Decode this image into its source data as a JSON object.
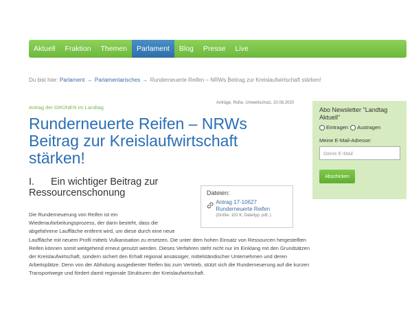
{
  "nav": {
    "items": [
      {
        "label": "Aktuell"
      },
      {
        "label": "Fraktion"
      },
      {
        "label": "Themen"
      },
      {
        "label": "Parlament"
      },
      {
        "label": "Blog"
      },
      {
        "label": "Presse"
      },
      {
        "label": "Live"
      }
    ],
    "active_index": 3
  },
  "breadcrumb": {
    "prefix": "Du bist hier:",
    "items": [
      "Parlament",
      "Parlamentarisches"
    ],
    "separator": "→",
    "current": "Runderneuerte Reifen – NRWs Beitrag zur Kreislaufwirtschaft stärken!"
  },
  "article": {
    "kicker": "Antrag der GRÜNEN im Landtag",
    "meta": "Anträge, Roße, Umweltschutz, 20.08.2020",
    "title": "Runderneuerte Reifen – NRWs Beitrag zur Kreislaufwirtschaft stärken!",
    "section_number": "I.",
    "section_title": "Ein wichtiger Beitrag zur Ressourcenschonung",
    "body_first": "Die Runderneuerung von Reifen ist ein Wiederaufarbeitungsprozess, der darin besteht, dass die abgefahrene Lauffläche entfernt wird, um diese durch eine neue",
    "body_rest": "Lauffläche mit neuem Profil mittels Vulkanisation zu ersetzen. Die unter dem hohen Einsatz von Ressourcen hergestellten Reifen können somit weitgehend erneut genutzt werden. Dieses Verfahren steht nicht nur im Einklang mit den Grundsätzen der Kreislaufwirtschaft, sondern sichert den Erhalt regional ansässiger, mittelständischer Unternehmen und deren Arbeitsplätze. Denn von der Abholung ausgedienter Reifen bis zum Vertrieb, stützt sich die Runderneuerung auf die kurzen Transportwege und fördert damit regionale Strukturen der Kreislaufwirtschaft."
  },
  "files": {
    "label": "Dateien:",
    "item": {
      "title": "Antrag 17-10627 Runderneuerte Reifen",
      "meta": "(Größe: 102 K, Dateityp: pdf, )"
    }
  },
  "newsletter": {
    "title": "Abo Newsletter \"Landtag Aktuell\"",
    "option_subscribe": "Eintragen",
    "option_unsubscribe": "Austragen",
    "email_label": "Meine E-Mail-Adresse:",
    "email_placeholder": "Deine E-Mail",
    "submit_label": "Abschicken"
  },
  "colors": {
    "nav_green": "#7ac24a",
    "nav_active": "#3b7fbf",
    "title_blue": "#2a6db5",
    "sidebar_bg": "#d6ebc0"
  }
}
